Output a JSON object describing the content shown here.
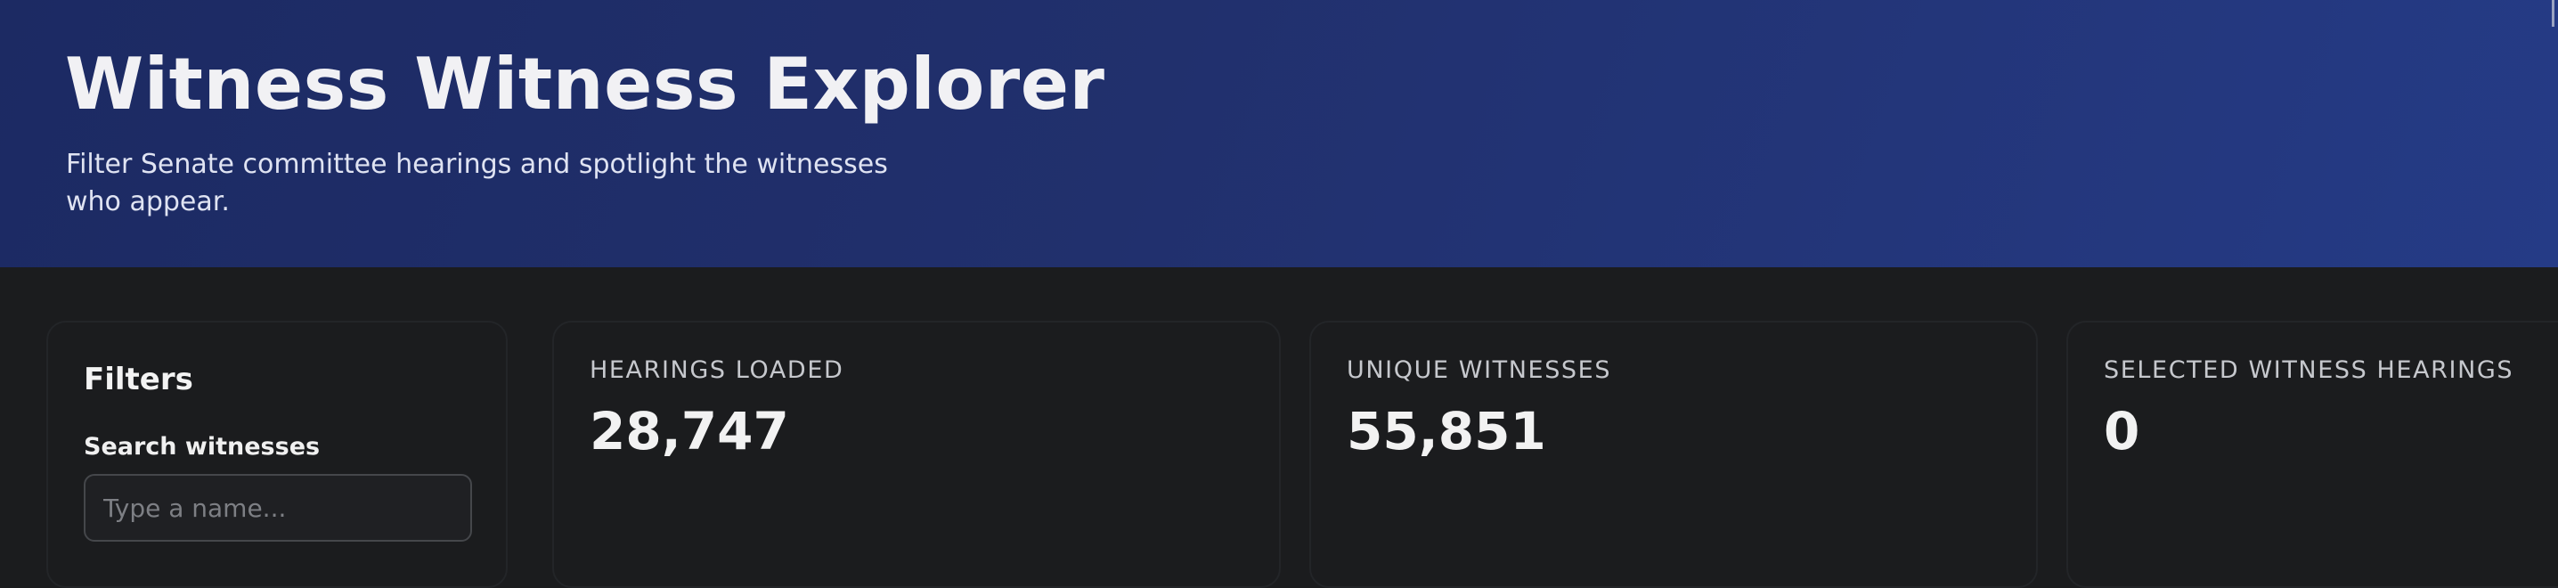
{
  "header": {
    "title": "Witness Witness Explorer",
    "subtitle": "Filter Senate committee hearings and spotlight the witnesses who appear."
  },
  "filters": {
    "title": "Filters",
    "search_label": "Search witnesses",
    "search_placeholder": "Type a name...",
    "search_value": ""
  },
  "stats": [
    {
      "label": "Hearings loaded",
      "value": "28,747"
    },
    {
      "label": "Unique witnesses",
      "value": "55,851"
    },
    {
      "label": "Selected witness hearings",
      "value": "0"
    }
  ],
  "colors": {
    "header_gradient_start": "#1c2a63",
    "header_gradient_end": "#253b86",
    "page_background": "#1b1c1e"
  }
}
